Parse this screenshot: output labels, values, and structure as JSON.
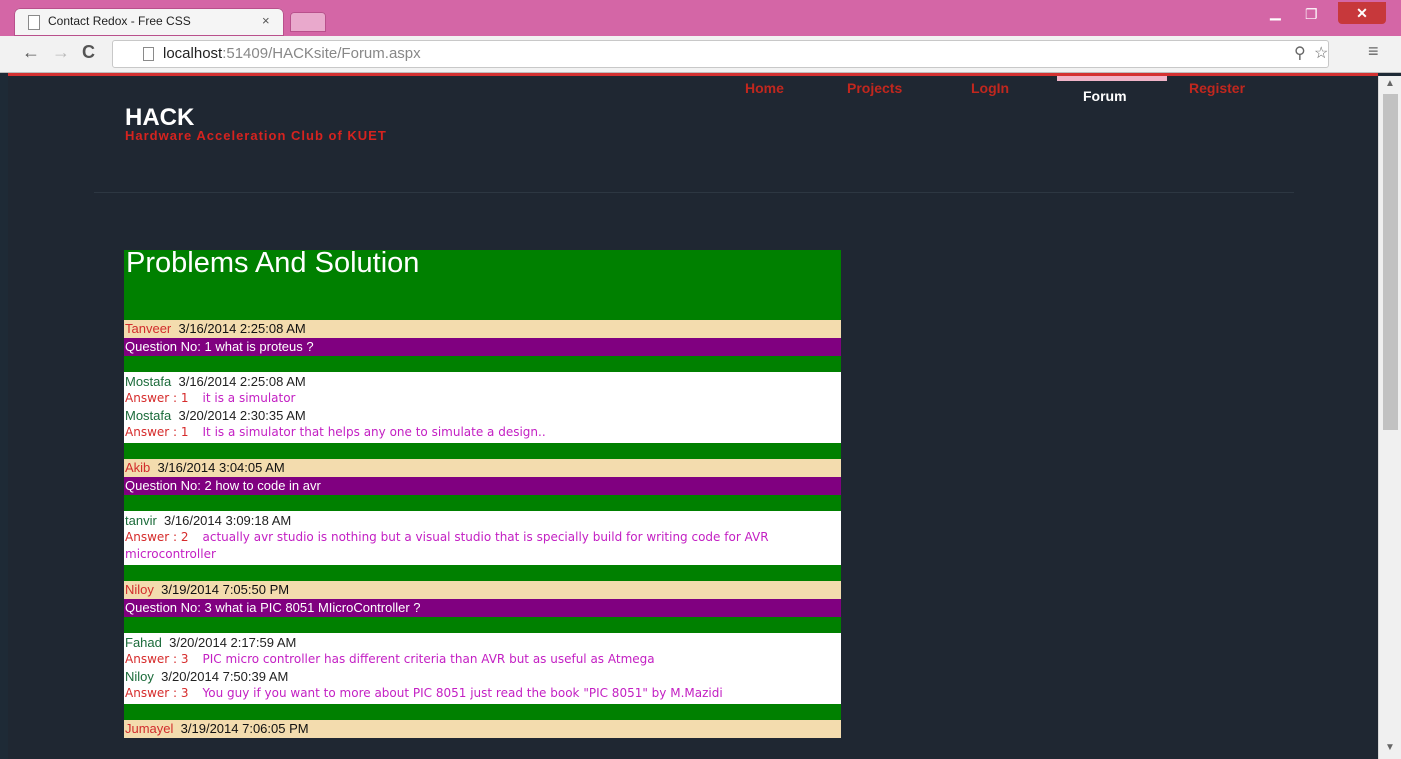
{
  "browser": {
    "tab_title": "Contact Redox - Free CSS",
    "tab_close": "×",
    "url_host": "localhost",
    "url_rest": ":51409/HACKsite/Forum.aspx"
  },
  "site": {
    "logo": "HACK",
    "tagline": "Hardware Acceleration Club of KUET",
    "nav": [
      "Home",
      "Projects",
      "LogIn",
      "Forum",
      "Register"
    ],
    "active_nav": "Forum"
  },
  "forum": {
    "title": "Problems And Solution",
    "questions": [
      {
        "user": "Tanveer",
        "date": "3/16/2014 2:25:08 AM",
        "text": "Question No: 1  what is proteus ?",
        "answers": [
          {
            "user": "Mostafa",
            "date": "3/16/2014 2:25:08 AM",
            "label": "Answer : 1",
            "text": "it is a simulator"
          },
          {
            "user": "Mostafa",
            "date": "3/20/2014 2:30:35 AM",
            "label": "Answer : 1",
            "text": "It is a simulator that helps any one to simulate a design.."
          }
        ]
      },
      {
        "user": "Akib",
        "date": "3/16/2014 3:04:05 AM",
        "text": "Question No: 2  how to code in avr",
        "answers": [
          {
            "user": "tanvir",
            "date": "3/16/2014 3:09:18 AM",
            "label": "Answer : 2",
            "text": "actually avr studio is nothing but a visual studio that is specially build for writing code for AVR microcontroller"
          }
        ]
      },
      {
        "user": "Niloy",
        "date": "3/19/2014 7:05:50 PM",
        "text": "Question No: 3  what ia PIC 8051 MIicroController ?",
        "answers": [
          {
            "user": "Fahad",
            "date": "3/20/2014 2:17:59 AM",
            "label": "Answer : 3",
            "text": "PIC micro controller has different criteria than AVR but as useful as Atmega"
          },
          {
            "user": "Niloy",
            "date": "3/20/2014 7:50:39 AM",
            "label": "Answer : 3",
            "text": "You guy if you want to more about PIC 8051 just read the book \"PIC 8051\" by M.Mazidi"
          }
        ]
      },
      {
        "user": "Jumayel",
        "date": "3/19/2014 7:06:05 PM",
        "text": "",
        "answers": []
      }
    ]
  },
  "colors": {
    "forum_bg": "#008000",
    "question_meta_bg": "#f3dcae",
    "question_bg": "#800080",
    "answer_text": "#c31fc3",
    "nav_link": "#c1271e"
  }
}
